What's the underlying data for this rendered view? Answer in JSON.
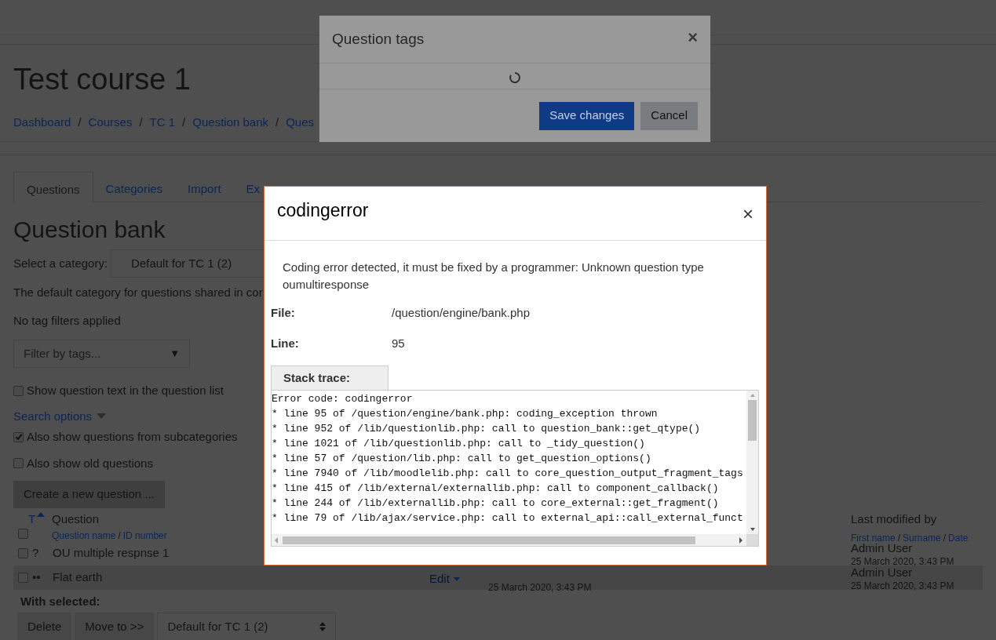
{
  "page": {
    "title": "Test course 1",
    "breadcrumb_separator": "/",
    "breadcrumbs": [
      "Dashboard",
      "Courses",
      "TC 1",
      "Question bank",
      "Ques"
    ]
  },
  "tabs": [
    {
      "label": "Questions",
      "selected": true
    },
    {
      "label": "Categories",
      "selected": false
    },
    {
      "label": "Import",
      "selected": false
    },
    {
      "label": "Ex",
      "selected": false
    }
  ],
  "heading": "Question bank",
  "category": {
    "label": "Select a category:",
    "value": "Default for TC 1 (2)"
  },
  "category_note": "The default category for questions shared in cor",
  "tag_filter_status": "No tag filters applied",
  "tag_filter": {
    "placeholder": "Filter by tags...",
    "arrow": "▼"
  },
  "show_text_option": {
    "label": "Show question text in the question list",
    "checked": false
  },
  "search_options_link": "Search options",
  "search_options": [
    {
      "label": "Also show questions from subcategories",
      "checked": true
    },
    {
      "label": "Also show old questions",
      "checked": false
    }
  ],
  "create_button": "Create a new question ...",
  "table": {
    "select_all_checked": false,
    "sort_separator": "/",
    "type_header": "T",
    "question_header": "Question",
    "question_sub": [
      "Question name",
      "ID number"
    ],
    "modified_header": "Last modified by",
    "modified_sub": [
      "First name",
      "Surname",
      "Date"
    ],
    "rows": [
      {
        "checked": false,
        "type_icon": "?",
        "name": "OU multiple respnse 1",
        "modified_by": "Admin User",
        "modified_date": "25 March 2020, 3:43 PM"
      },
      {
        "checked": false,
        "type_icon": "••",
        "name": "Flat earth",
        "action": "Edit",
        "created_date": "25 March 2020, 3:43 PM",
        "modified_by": "Admin User",
        "modified_date": "25 March 2020, 3:43 PM"
      }
    ]
  },
  "with_selected": {
    "label": "With selected:",
    "buttons": [
      "Delete",
      "Move to >>"
    ],
    "target": "Default for TC 1 (2)"
  },
  "tags_dialog": {
    "title": "Question tags",
    "close": "×",
    "loading": true,
    "buttons": [
      {
        "label": "Save changes",
        "kind": "primary"
      },
      {
        "label": "Cancel",
        "kind": "secondary"
      }
    ]
  },
  "error_dialog": {
    "title": "codingerror",
    "close": "×",
    "message": "Coding error detected, it must be fixed by a programmer: Unknown question type oumultiresponse",
    "fields": [
      {
        "label": "File:",
        "value": "/question/engine/bank.php"
      },
      {
        "label": "Line:",
        "value": "95"
      }
    ],
    "stack_trace_tab": "Stack trace:",
    "stack_trace": [
      "Error code: codingerror",
      "* line 95 of /question/engine/bank.php: coding_exception thrown",
      "* line 952 of /lib/questionlib.php: call to question_bank::get_qtype()",
      "* line 1021 of /lib/questionlib.php: call to _tidy_question()",
      "* line 57 of /question/lib.php: call to get_question_options()",
      "* line 7940 of /lib/moodlelib.php: call to core_question_output_fragment_tags",
      "* line 415 of /lib/external/externallib.php: call to component_callback()",
      "* line 244 of /lib/externallib.php: call to core_external::get_fragment()",
      "* line 79 of /lib/ajax/service.php: call to external_api::call_external_funct"
    ]
  }
}
